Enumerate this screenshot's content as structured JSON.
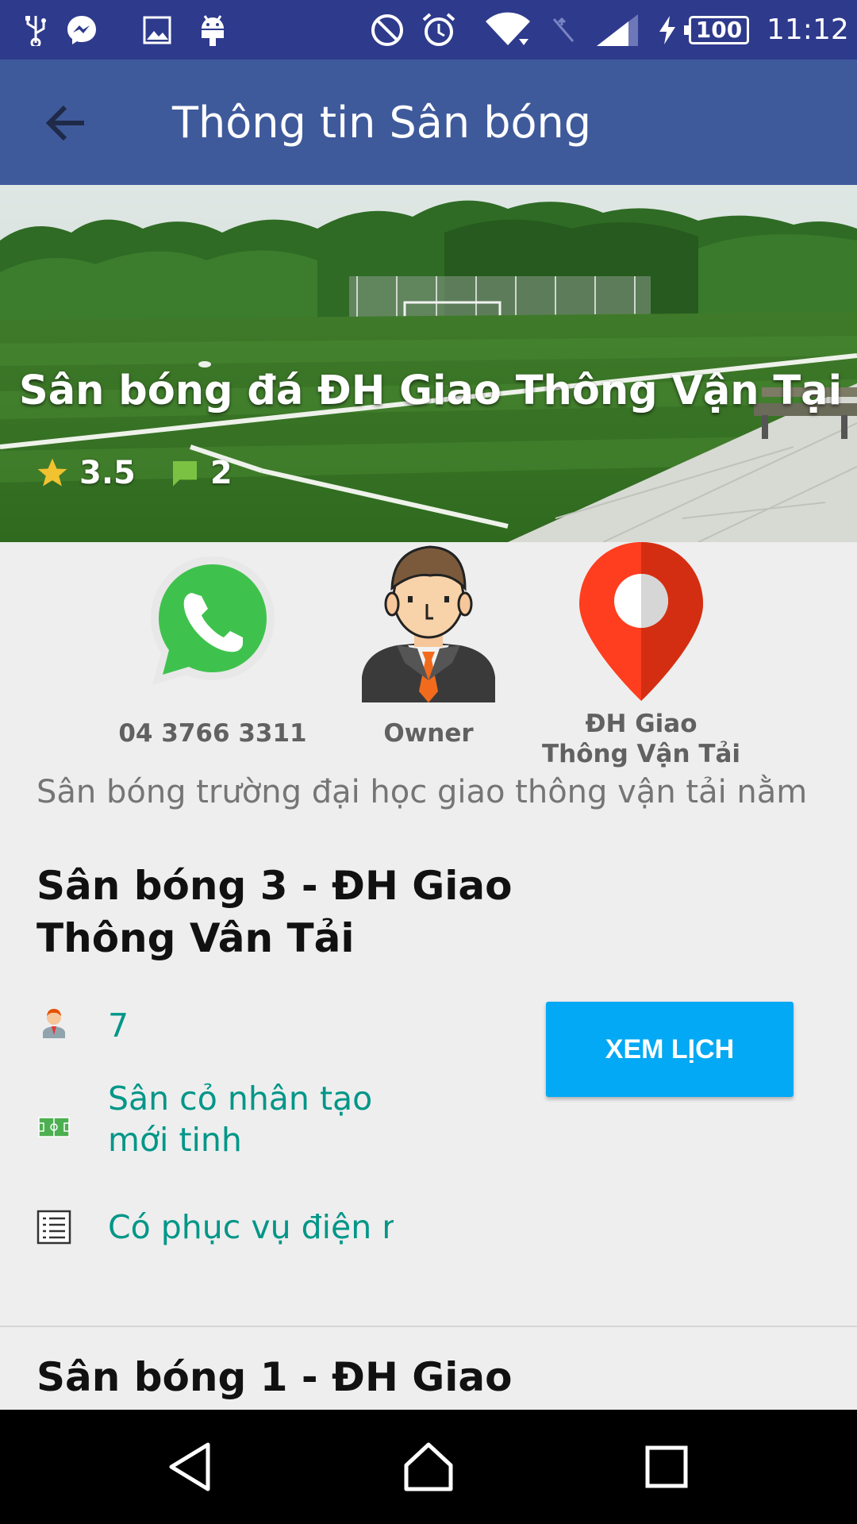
{
  "status_bar": {
    "battery": "100",
    "time": "11:12",
    "icons": [
      "usb-icon",
      "messenger-icon",
      "image-icon",
      "android-icon",
      "do-not-disturb-icon",
      "alarm-icon",
      "wifi-icon",
      "no-signal-icon",
      "cell-signal-icon",
      "charging-icon",
      "battery-icon"
    ]
  },
  "app_bar": {
    "title": "Thông tin Sân bóng",
    "back_icon": "arrow-back-icon"
  },
  "hero": {
    "field_name": "Sân bóng đá ĐH Giao Thông Vận Tại",
    "rating": "3.5",
    "comments": "2",
    "colors": {
      "star": "#f2c230",
      "comment": "#7cc242"
    }
  },
  "contacts": {
    "phone": "04 3766 3311",
    "owner": "Owner",
    "location_line1": "ĐH Giao",
    "location_line2": "Thông Vận Tải"
  },
  "description": "Sân bóng trường đại học giao thông vận tải nằm",
  "fields": [
    {
      "title_line1": "Sân bóng 3 - ĐH Giao",
      "title_line2": "Thông Vân Tải",
      "players": "7",
      "surface_line1": "Sân cỏ nhân tạo",
      "surface_line2": "mới tinh",
      "service": "Có phục vụ điện nư",
      "button": "XEM LỊCH"
    },
    {
      "title_line1": "Sân bóng 1 - ĐH Giao"
    }
  ],
  "nav_bar": {
    "back": "nav-back-icon",
    "home": "nav-home-icon",
    "recents": "nav-recents-icon"
  },
  "colors": {
    "status_bar": "#2e3a8c",
    "app_bar": "#3f5a9b",
    "accent_button": "#03a9f4",
    "attribute_text": "#009688"
  }
}
